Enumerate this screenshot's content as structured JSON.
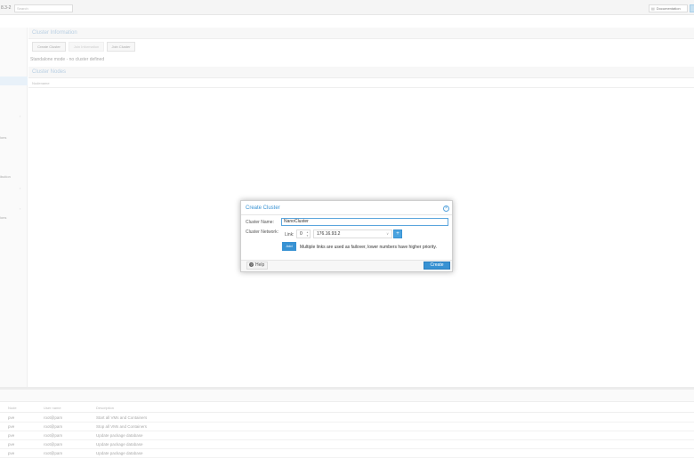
{
  "topbar": {
    "version": "8.3-2",
    "search_placeholder": "Search",
    "documentation_label": "Documentation"
  },
  "leftnav": {
    "items": [
      "",
      "",
      "",
      "ions",
      "",
      "",
      "",
      "ibution",
      "",
      "",
      "ions"
    ]
  },
  "cluster_info": {
    "title": "Cluster Information",
    "buttons": [
      "Create Cluster",
      "Join Information",
      "Join Cluster"
    ],
    "standalone_text": "Standalone mode - no cluster defined"
  },
  "cluster_nodes": {
    "title": "Cluster Nodes",
    "column_header": "Nodename"
  },
  "dialog": {
    "title": "Create Cluster",
    "cluster_name_label": "Cluster Name:",
    "cluster_name_value": "NanoCluster",
    "cluster_network_label": "Cluster Network:",
    "link_label": "Link:",
    "link_number": "0",
    "link_ip": "176.16.93.2",
    "add_label": "Add",
    "info_text": "Multiple links are used as failover, lower numbers have higher priority.",
    "help_label": "Help",
    "create_label": "Create"
  },
  "log": {
    "columns": [
      "Node",
      "User name",
      "Description"
    ],
    "rows": [
      {
        "node": "pve",
        "user": "root@pam",
        "description": "Start all VMs and Containers"
      },
      {
        "node": "pve",
        "user": "root@pam",
        "description": "Stop all VMs and Containers"
      },
      {
        "node": "pve",
        "user": "root@pam",
        "description": "Update package database"
      },
      {
        "node": "pve",
        "user": "root@pam",
        "description": "Update package database"
      },
      {
        "node": "pve",
        "user": "root@pam",
        "description": "Update package database"
      }
    ]
  },
  "colors": {
    "accent": "#3892d3",
    "dialog_title": "#3892d3"
  }
}
